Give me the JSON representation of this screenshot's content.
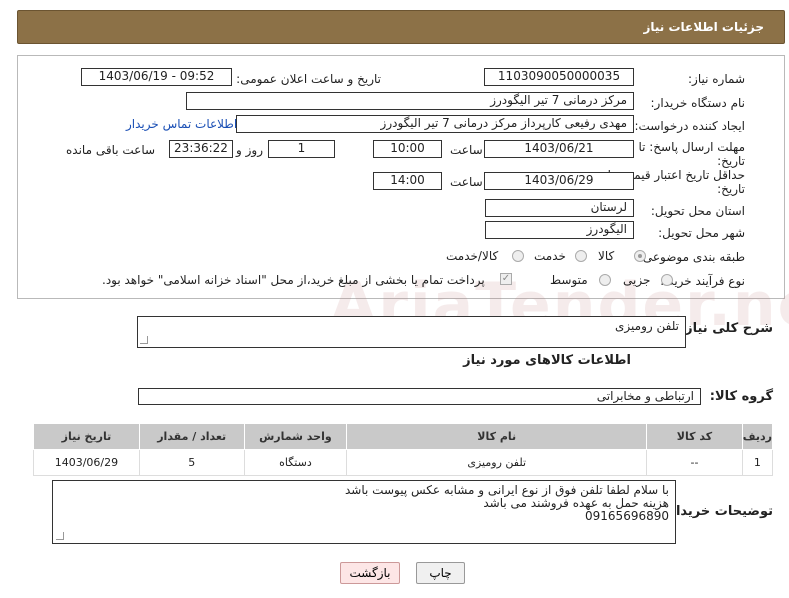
{
  "header": {
    "title": "جزئیات اطلاعات نیاز"
  },
  "form": {
    "need_number_label": "شماره نیاز:",
    "need_number": "1103090050000035",
    "announce_label": "تاریخ و ساعت اعلان عمومی:",
    "announce_value": "1403/06/19 - 09:52",
    "buyer_org_label": "نام دستگاه خریدار:",
    "buyer_org": "مرکز درمانی 7 تیر الیگودرز",
    "creator_label": "ایجاد کننده درخواست:",
    "creator": "مهدی رفیعی کارپرداز مرکز درمانی 7 تیر الیگودرز",
    "contact_link": "اطلاعات تماس خریدار",
    "deadline_label_1": "مهلت ارسال پاسخ: تا",
    "deadline_label_2": "تاریخ:",
    "deadline_date": "1403/06/21",
    "time_label": "ساعت",
    "deadline_time": "10:00",
    "days_value": "1",
    "days_label": "روز و",
    "remaining_time": "23:36:22",
    "remaining_label": "ساعت باقی مانده",
    "min_validity_label_1": "حداقل تاریخ اعتبار قیمت: تا",
    "min_validity_label_2": "تاریخ:",
    "validity_date": "1403/06/29",
    "validity_time": "14:00",
    "province_label": "استان محل تحویل:",
    "province": "لرستان",
    "city_label": "شهر محل تحویل:",
    "city": "الیگودرز",
    "category_label": "طبقه بندی موضوعی:",
    "category_options": [
      "کالا",
      "خدمت",
      "کالا/خدمت"
    ],
    "process_label": "نوع فرآیند خرید :",
    "process_options": [
      "جزیی",
      "متوسط"
    ],
    "payment_note": "پرداخت تمام یا بخشی از مبلغ خرید،از محل \"اسناد خزانه اسلامی\" خواهد بود."
  },
  "description": {
    "label": "شرح کلی نیاز:",
    "value": "تلفن رومیزی"
  },
  "goods_section": {
    "title": "اطلاعات کالاهای مورد نیاز",
    "group_label": "گروه کالا:",
    "group_value": "ارتباطی و مخابراتی"
  },
  "table": {
    "headers": [
      "ردیف",
      "کد کالا",
      "نام کالا",
      "واحد شمارش",
      "تعداد / مقدار",
      "تاریخ نیاز"
    ],
    "rows": [
      [
        "1",
        "--",
        "تلفن رومیزی",
        "دستگاه",
        "5",
        "1403/06/29"
      ]
    ]
  },
  "buyer_notes": {
    "label": "توضیحات خریدار:",
    "lines": [
      "با سلام لطفا تلفن فوق از نوع ایرانی و مشابه عکس پیوست باشد",
      "هزینه حمل به عهده فروشند می باشد",
      "09165696890"
    ]
  },
  "buttons": {
    "print": "چاپ",
    "back": "بازگشت"
  },
  "watermark": "AriaTender.net"
}
